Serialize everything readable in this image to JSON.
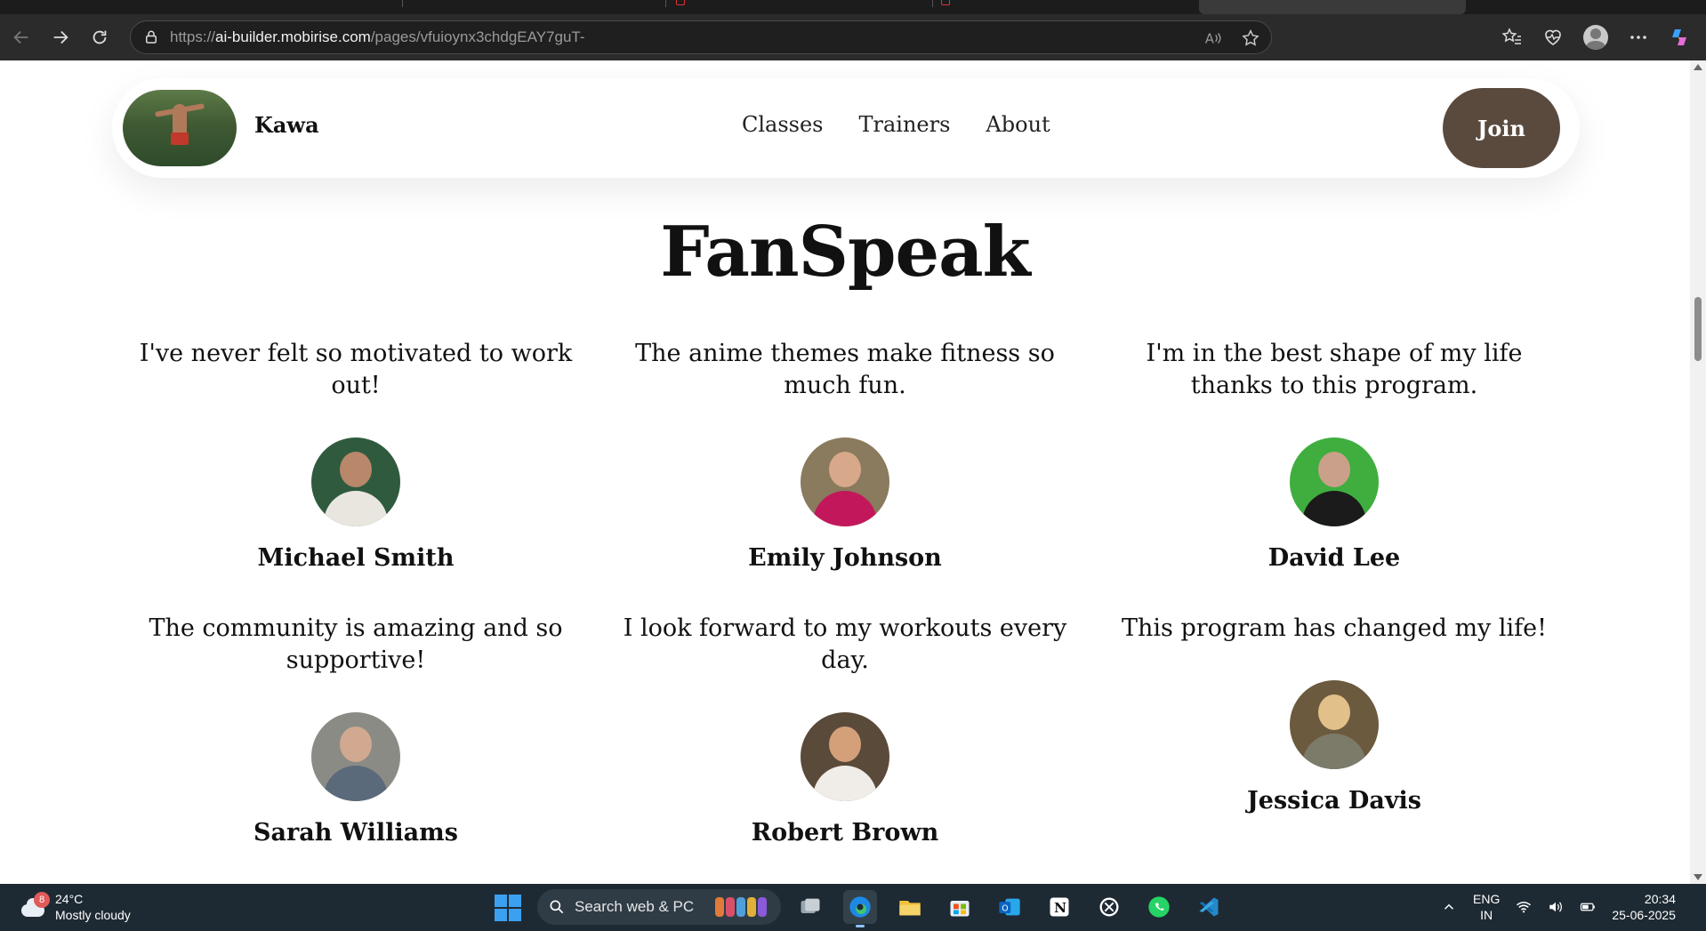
{
  "browser": {
    "url_prefix": "https://",
    "url_host": "ai-builder.mobirise.com",
    "url_path": "/pages/vfuioynx3chdgEAY7guT-"
  },
  "site": {
    "brand": "Kawa",
    "menu": [
      "Classes",
      "Trainers",
      "About"
    ],
    "join_label": "Join"
  },
  "section": {
    "title": "FanSpeak"
  },
  "testimonials": [
    {
      "quote": "I've never felt so motivated to work out!",
      "name": "Michael Smith"
    },
    {
      "quote": "The anime themes make fitness so much fun.",
      "name": "Emily Johnson"
    },
    {
      "quote": "I'm in the best shape of my life thanks to this program.",
      "name": "David Lee"
    },
    {
      "quote": "The community is amazing and so supportive!",
      "name": "Sarah Williams"
    },
    {
      "quote": "I look forward to my workouts every day.",
      "name": "Robert Brown"
    },
    {
      "quote": "This program has changed my life!",
      "name": "Jessica Davis"
    }
  ],
  "taskbar": {
    "weather_badge": "8",
    "temperature": "24°C",
    "condition": "Mostly cloudy",
    "search_placeholder": "Search web & PC",
    "lang_line1": "ENG",
    "lang_line2": "IN",
    "time": "20:34",
    "date": "25-06-2025"
  },
  "colors": {
    "join_button": "#5a4a3e",
    "taskbar": "#1e2a33",
    "browser_toolbar": "#2b2b2b"
  }
}
